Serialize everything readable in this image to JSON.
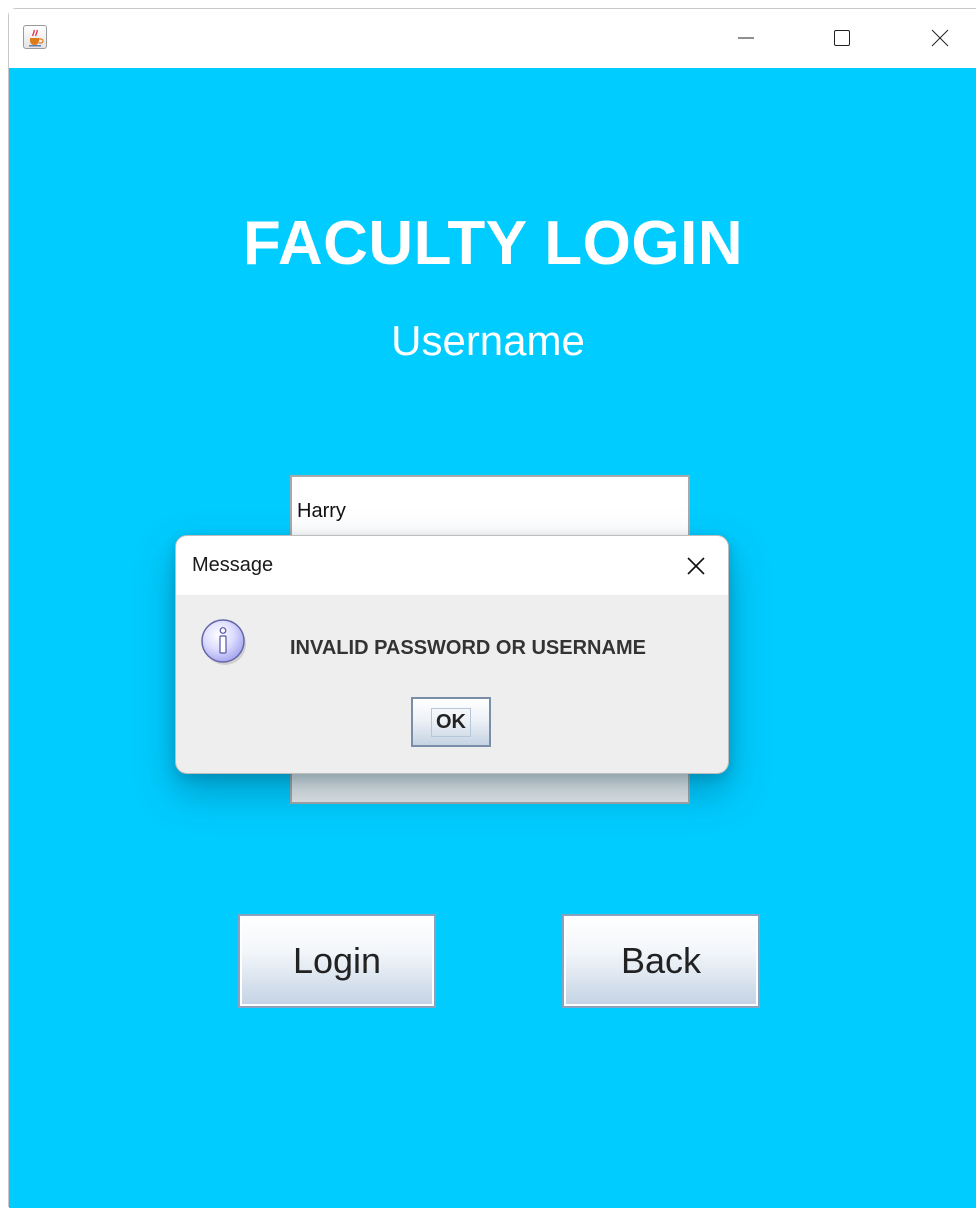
{
  "window": {
    "app_icon": "java-cup-icon",
    "controls": [
      "minimize-icon",
      "maximize-icon",
      "close-icon"
    ]
  },
  "colors": {
    "background": "#00ccff",
    "heading_text": "#ffffff"
  },
  "form": {
    "heading": "FACULTY LOGIN",
    "username_label": "Username",
    "username_value": "Harry",
    "login_label": "Login",
    "back_label": "Back"
  },
  "dialog": {
    "title": "Message",
    "icon": "info-icon",
    "message": "INVALID PASSWORD OR USERNAME",
    "ok_label": "OK"
  }
}
